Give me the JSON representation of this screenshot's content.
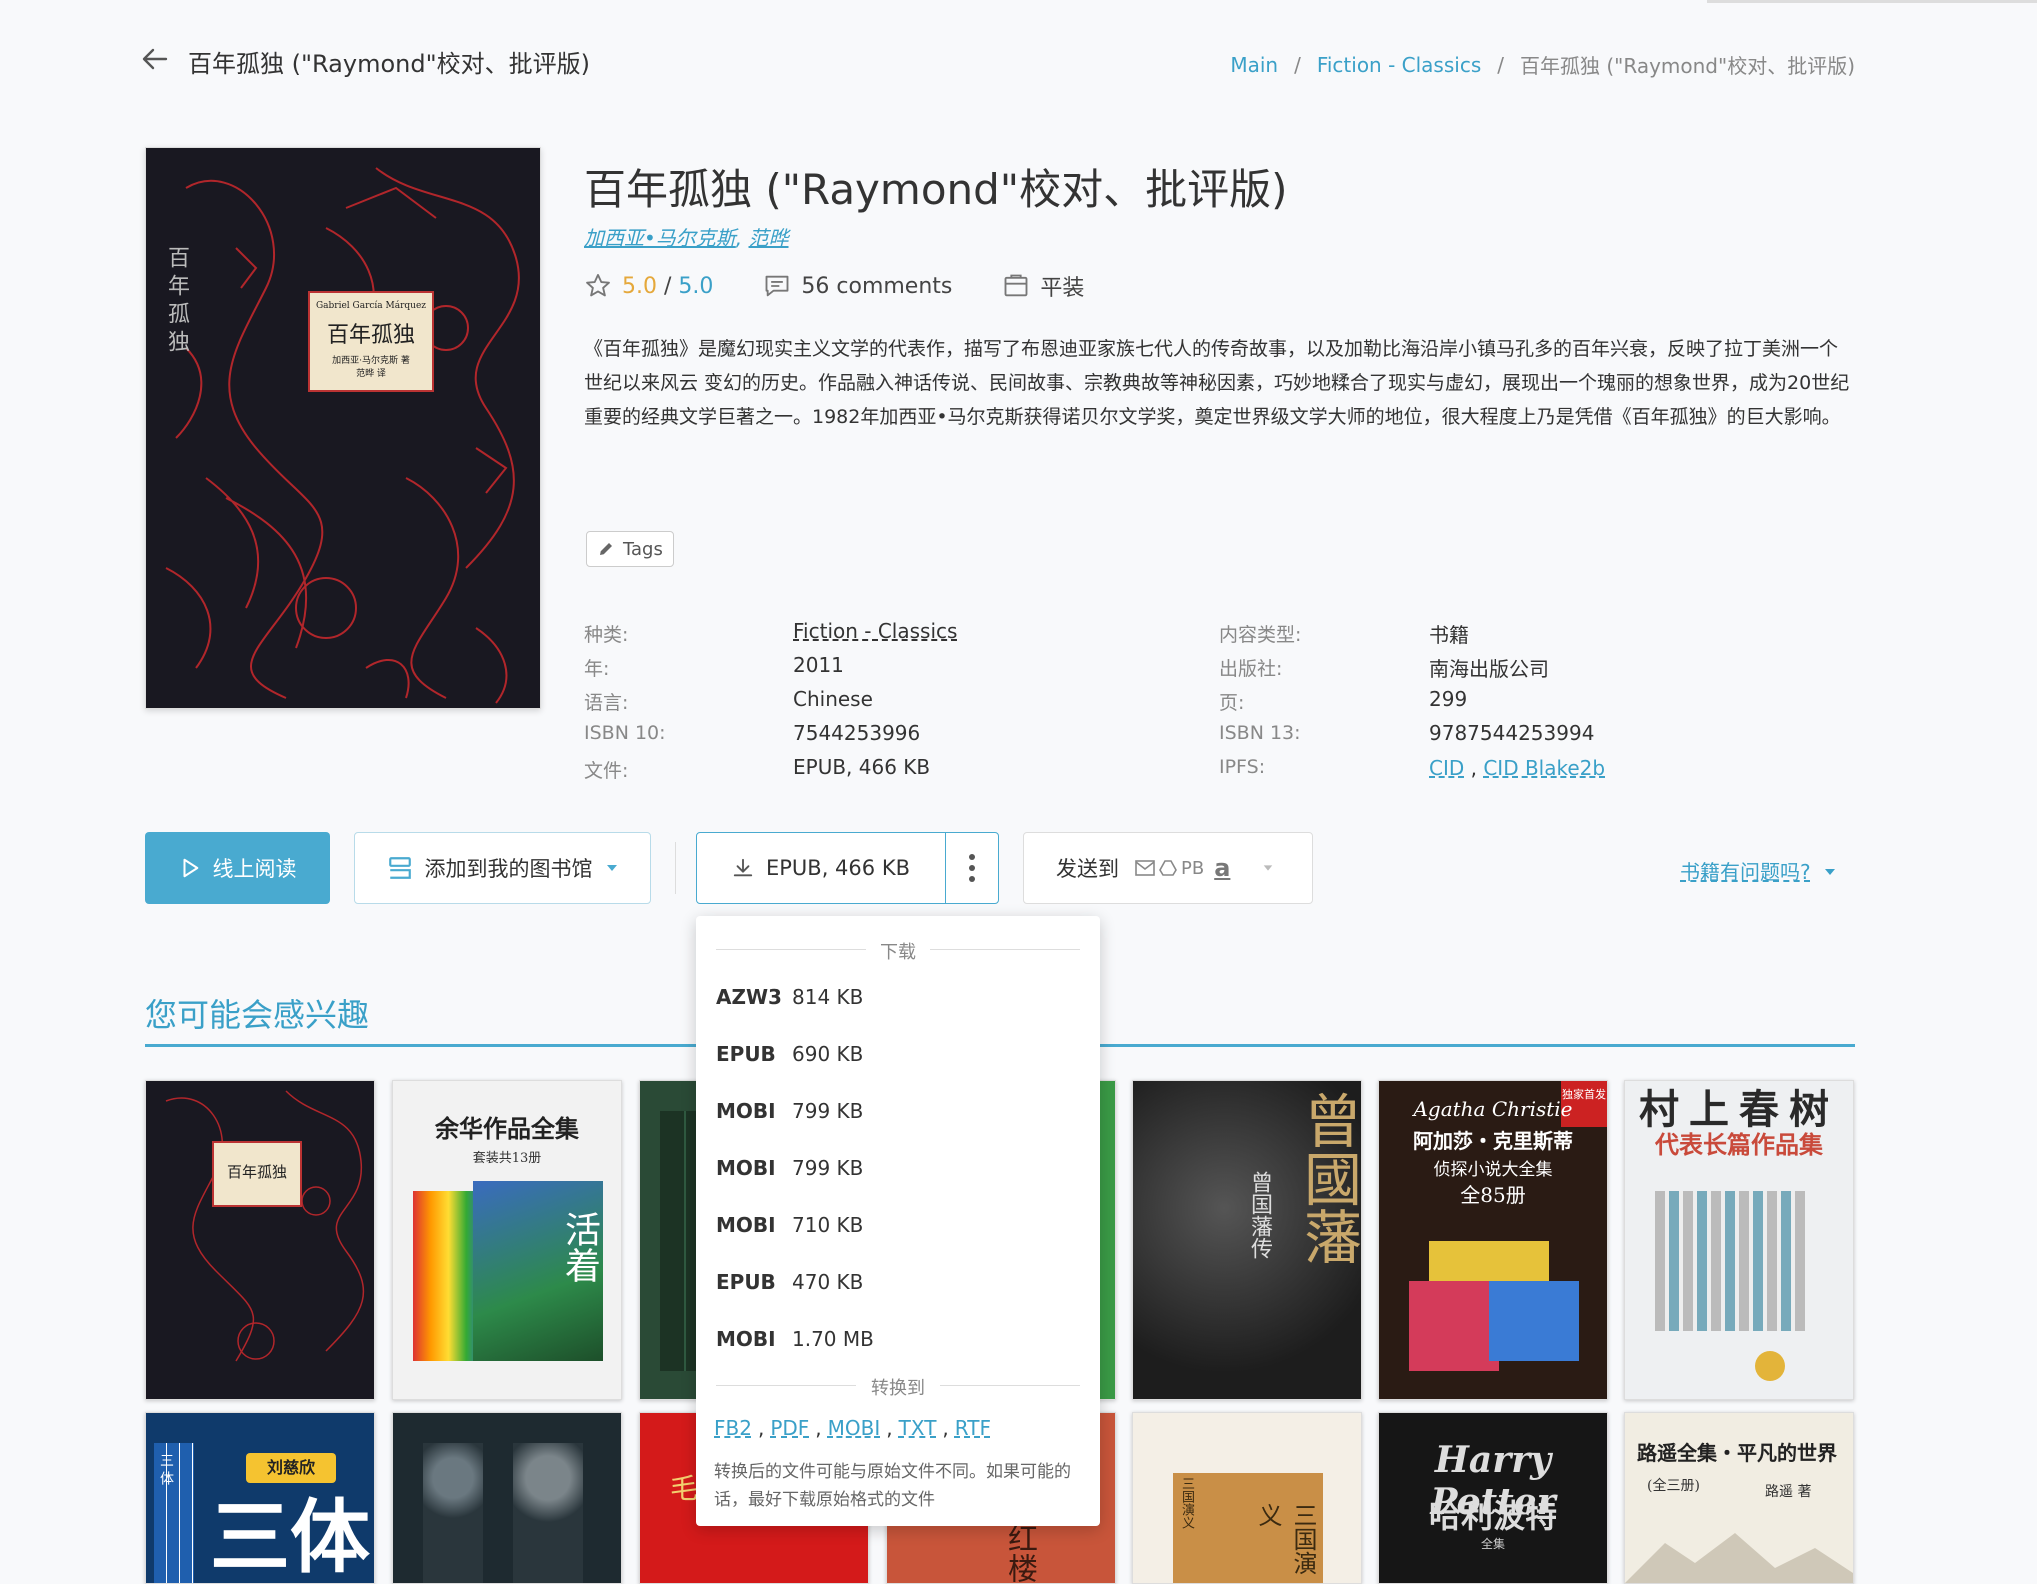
{
  "header": {
    "title": "百年孤独 (\"Raymond\"校对、批评版)",
    "breadcrumb": [
      "Main",
      "Fiction - Classics",
      "百年孤独 (\"Raymond\"校对、批评版)"
    ]
  },
  "book": {
    "title": "百年孤独 (\"Raymond\"校对、批评版)",
    "authors": [
      "加西亚•马尔克斯",
      "范晔"
    ],
    "author_sep": ", ",
    "rating": "5.0",
    "rating_sep": " / ",
    "rating_max": "5.0",
    "comments": "56 comments",
    "binding": "平装",
    "description": "《百年孤独》是魔幻现实主义文学的代表作，描写了布恩迪亚家族七代人的传奇故事，以及加勒比海沿岸小镇马孔多的百年兴衰，反映了拉丁美洲一个世纪以来风云 变幻的历史。作品融入神话传说、民间故事、宗教典故等神秘因素，巧妙地糅合了现实与虚幻，展现出一个瑰丽的想象世界，成为20世纪重要的经典文学巨著之一。1982年加西亚•马尔克斯获得诺贝尔文学奖，奠定世界级文学大师的地位，很大程度上乃是凭借《百年孤独》的巨大影响。",
    "tags_label": "Tags",
    "cover": {
      "author_en": "Gabriel García Márquez",
      "title": "百年孤独",
      "sub": "加西亚·马尔克斯 著",
      "translator": "范晔 译",
      "vertical": "百年孤独"
    }
  },
  "details": {
    "left": [
      {
        "label": "种类:",
        "value": "Fiction - Classics"
      },
      {
        "label": "年:",
        "value": "2011"
      },
      {
        "label": "语言:",
        "value": "Chinese"
      },
      {
        "label": "ISBN 10:",
        "value": "7544253996"
      },
      {
        "label": "文件:",
        "value": "EPUB, 466 KB"
      }
    ],
    "right": [
      {
        "label": "内容类型:",
        "value": "书籍"
      },
      {
        "label": "出版社:",
        "value": "南海出版公司"
      },
      {
        "label": "页:",
        "value": "299"
      },
      {
        "label": "ISBN 13:",
        "value": "9787544253994"
      },
      {
        "label": "IPFS:",
        "value": ""
      }
    ],
    "ipfs": [
      "CID",
      "CID Blake2b"
    ],
    "ipfs_sep": " , "
  },
  "actions": {
    "read_online": "线上阅读",
    "add_to_shelf": "添加到我的图书馆",
    "download": "EPUB, 466 KB",
    "send_to": "发送到",
    "send_pb": "PB",
    "send_amazon": "a",
    "report_issue": "书籍有问题吗?"
  },
  "dropdown": {
    "download_header": "下载",
    "files": [
      {
        "format": "AZW3",
        "size": "814 KB"
      },
      {
        "format": "EPUB",
        "size": "690 KB"
      },
      {
        "format": "MOBI",
        "size": "799 KB"
      },
      {
        "format": "MOBI",
        "size": "799 KB"
      },
      {
        "format": "MOBI",
        "size": "710 KB"
      },
      {
        "format": "EPUB",
        "size": "470 KB"
      },
      {
        "format": "MOBI",
        "size": "1.70 MB"
      }
    ],
    "convert_header": "转换到",
    "convert_formats": [
      "FB2",
      "PDF",
      "MOBI",
      "TXT",
      "RTF"
    ],
    "convert_sep": ",",
    "convert_note": "转换后的文件可能与原始文件不同。如果可能的话，最好下载原始格式的文件"
  },
  "recommendations": {
    "title": "您可能会感兴趣",
    "covers": [
      {
        "caption": "百年孤独"
      },
      {
        "caption": "余华作品全集",
        "sub": "套装共13册",
        "extra": "活着"
      },
      {
        "caption": ""
      },
      {
        "caption": ""
      },
      {
        "caption": "曾国藩传",
        "extra": "曾國藩"
      },
      {
        "caption": "阿加莎・克里斯蒂",
        "sub": "侦探小说大全集",
        "extra": "全85册",
        "badge": "独家首发",
        "script": "Agatha Christie"
      },
      {
        "caption": "村上春树",
        "sub": "代表长篇作品集"
      },
      {
        "caption": "刘慈欣",
        "extra": "三体",
        "spines": "三体"
      },
      {
        "caption": ""
      },
      {
        "caption": "毛"
      },
      {
        "caption": "红楼"
      },
      {
        "caption": "三国演义",
        "spines": "三国演义"
      },
      {
        "caption": "Harry Potter",
        "sub": "哈利波特",
        "extra": "全集"
      },
      {
        "caption": "路遥全集・平凡的世界",
        "sub": "(全三册)",
        "extra": "路遥 著"
      }
    ]
  },
  "colors": {
    "accent": "#49aad0",
    "link": "#3aa0c8",
    "star": "#e5a83b",
    "cover_dark": "#191821"
  }
}
